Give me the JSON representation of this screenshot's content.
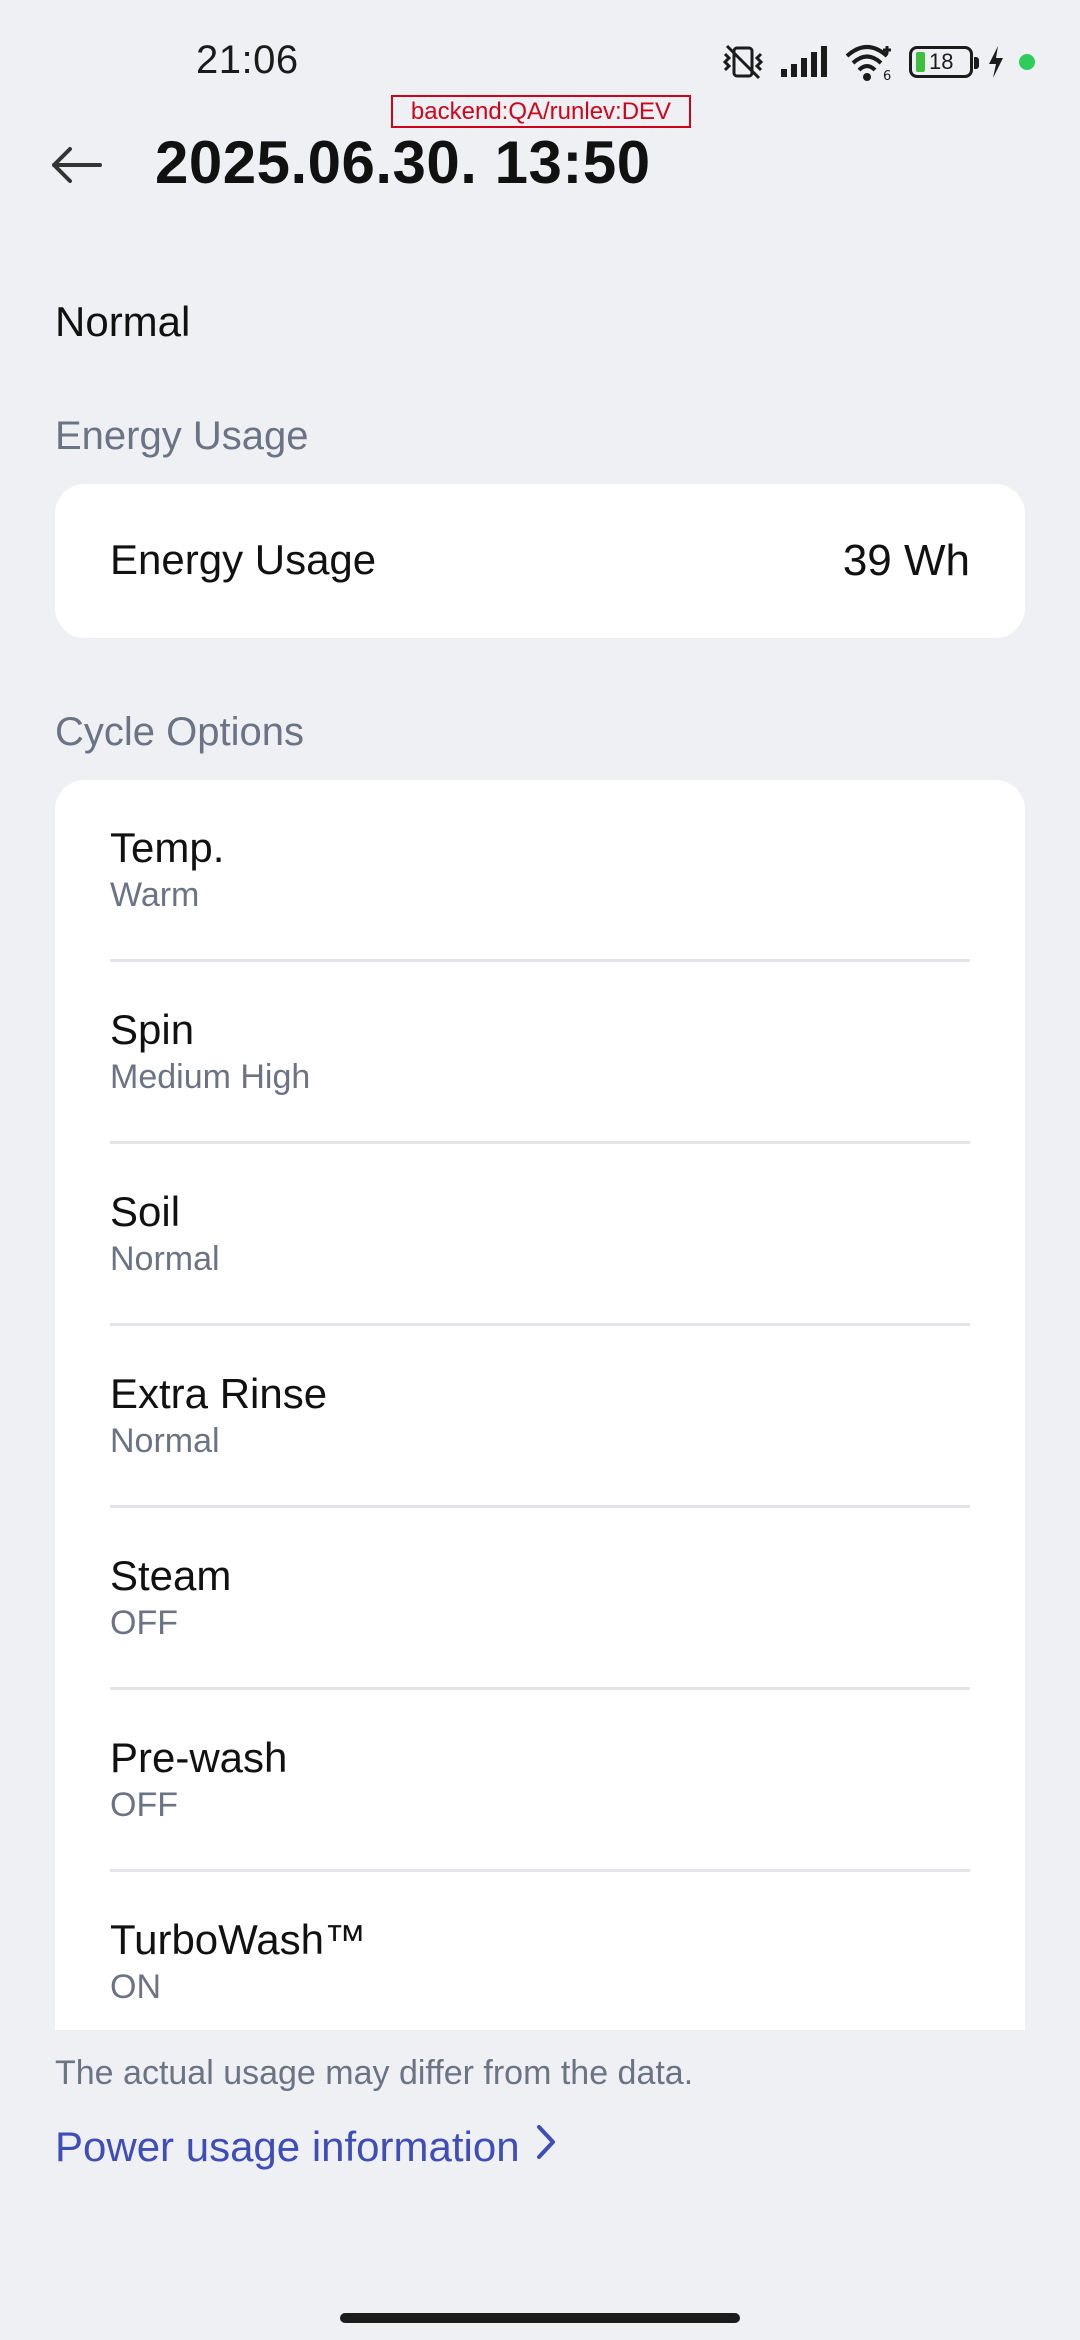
{
  "status_bar": {
    "time": "21:06",
    "battery_level": "18",
    "icons": [
      "vibrate-mute-icon",
      "signal-icon",
      "wifi-icon",
      "battery-icon",
      "charging-icon",
      "status-dot-icon"
    ]
  },
  "debug": {
    "badge": "backend:QA/runlev:DEV"
  },
  "header": {
    "back_icon": "back-arrow-icon",
    "title": "2025.06.30. 13:50"
  },
  "course": {
    "name": "Normal"
  },
  "energy": {
    "section_title": "Energy Usage",
    "label": "Energy Usage",
    "value": "39 Wh"
  },
  "cycle_options": {
    "section_title": "Cycle Options",
    "items": [
      {
        "title": "Temp.",
        "value": "Warm"
      },
      {
        "title": "Spin",
        "value": "Medium High"
      },
      {
        "title": "Soil",
        "value": "Normal"
      },
      {
        "title": "Extra Rinse",
        "value": "Normal"
      },
      {
        "title": "Steam",
        "value": "OFF"
      },
      {
        "title": "Pre-wash",
        "value": "OFF"
      },
      {
        "title": "TurboWash™",
        "value": "ON"
      }
    ]
  },
  "footer": {
    "note": "The actual usage may differ from the data.",
    "link_label": "Power usage information",
    "link_icon": "chevron-right-icon"
  },
  "colors": {
    "background": "#eff0f4",
    "card": "#ffffff",
    "secondary_text": "#6b7385",
    "link": "#3f4db8",
    "debug": "#d0021b"
  }
}
